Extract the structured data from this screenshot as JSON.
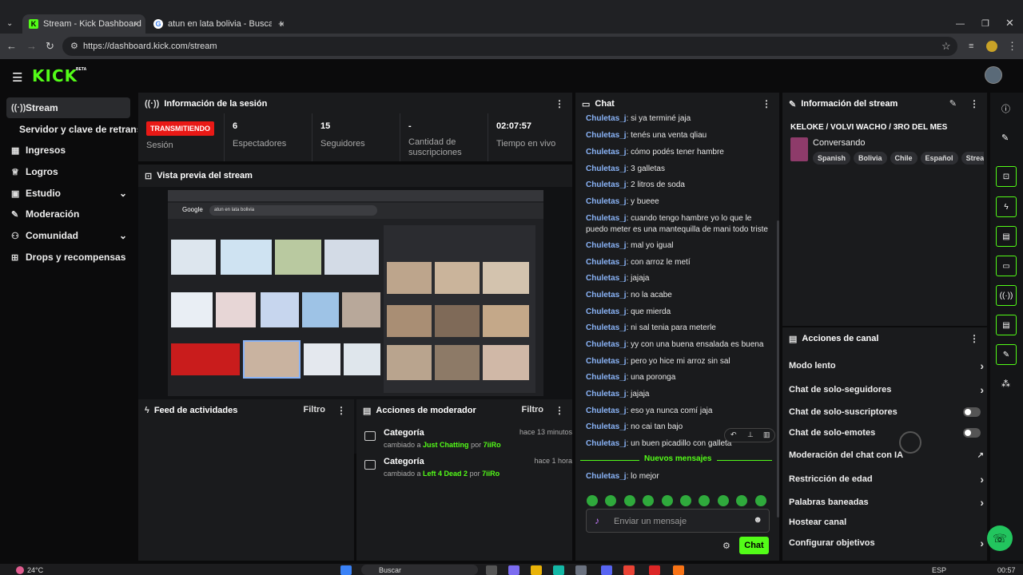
{
  "browser": {
    "tabs": [
      {
        "title": "Stream - Kick Dashboard",
        "active": true
      },
      {
        "title": "atun en lata bolivia - Buscar con",
        "active": false
      }
    ],
    "new_tab": "+",
    "url": "https://dashboard.kick.com/stream"
  },
  "header": {
    "logo": "KICK",
    "beta": "BETA"
  },
  "sidebar": {
    "items": [
      {
        "label": "Stream",
        "icon": "broadcast-icon"
      },
      {
        "label": "Servidor y clave de retransmisión",
        "icon": ""
      },
      {
        "label": "Ingresos",
        "icon": "chart-icon"
      },
      {
        "label": "Logros",
        "icon": "trophy-icon"
      },
      {
        "label": "Estudio",
        "icon": "studio-icon"
      },
      {
        "label": "Moderación",
        "icon": "wrench-icon"
      },
      {
        "label": "Comunidad",
        "icon": "community-icon"
      },
      {
        "label": "Drops y recompensas",
        "icon": "gift-icon"
      }
    ]
  },
  "session": {
    "title": "Información de la sesión",
    "badge": "TRANSMITIENDO",
    "badge_label": "Sesión",
    "stats": [
      {
        "value": "6",
        "label": "Espectadores"
      },
      {
        "value": "15",
        "label": "Seguidores"
      },
      {
        "value": "-",
        "label": "Cantidad de suscripciones"
      },
      {
        "value": "02:07:57",
        "label": "Tiempo en vivo"
      }
    ]
  },
  "preview": {
    "title": "Vista previa del stream",
    "embedded_search": "atun en lata bolivia",
    "embedded_logo": "Google"
  },
  "feed": {
    "title": "Feed de actividades",
    "filter": "Filtro"
  },
  "mod_actions": {
    "title": "Acciones de moderador",
    "filter": "Filtro",
    "items": [
      {
        "title": "Categoría",
        "prefix": "cambiado a",
        "value": "Just Chatting",
        "by": "por",
        "user": "7iiRo",
        "time": "hace 13 minutos"
      },
      {
        "title": "Categoría",
        "prefix": "cambiado a",
        "value": "Left 4 Dead 2",
        "by": "por",
        "user": "7iiRo",
        "time": "hace 1 hora"
      }
    ]
  },
  "chat": {
    "title": "Chat",
    "messages": [
      {
        "user": "Chuletas_j",
        "text": ": si ya terminé jaja"
      },
      {
        "user": "Chuletas_j",
        "text": ": tenés una venta qliau"
      },
      {
        "user": "Chuletas_j",
        "text": ": cómo podés tener hambre"
      },
      {
        "user": "Chuletas_j",
        "text": ": 3 galletas"
      },
      {
        "user": "Chuletas_j",
        "text": ": 2 litros de soda"
      },
      {
        "user": "Chuletas_j",
        "text": ": y bueee"
      },
      {
        "user": "Chuletas_j",
        "text": ": cuando tengo hambre yo lo que le puedo meter es una mantequilla de mani todo triste"
      },
      {
        "user": "Chuletas_j",
        "text": ": mal yo igual"
      },
      {
        "user": "Chuletas_j",
        "text": ": con arroz le metí"
      },
      {
        "user": "Chuletas_j",
        "text": ": jajaja"
      },
      {
        "user": "Chuletas_j",
        "text": ": no la acabe"
      },
      {
        "user": "Chuletas_j",
        "text": ": que mierda"
      },
      {
        "user": "Chuletas_j",
        "text": ": ni sal tenia para meterle"
      },
      {
        "user": "Chuletas_j",
        "text": ": yy con una buena ensalada es buena"
      },
      {
        "user": "Chuletas_j",
        "text": ": pero yo hice mi arroz sin sal"
      },
      {
        "user": "Chuletas_j",
        "text": ": una poronga"
      },
      {
        "user": "Chuletas_j",
        "text": ": jajaja"
      },
      {
        "user": "Chuletas_j",
        "text": ": eso ya nunca comí jaja"
      },
      {
        "user": "Chuletas_j",
        "text": ": no cai tan bajo"
      },
      {
        "user": "Chuletas_j",
        "text": ": un buen picadillo con galleta"
      }
    ],
    "new_messages": "Nuevos mensajes",
    "after": {
      "user": "Chuletas_j",
      "text": ": lo mejor"
    },
    "input_placeholder": "Enviar un mensaje",
    "send_label": "Chat"
  },
  "stream_info": {
    "title": "Información del stream",
    "stream_title": "KELOKE / VOLVI WACHO / 3RO DEL MES",
    "category": "Conversando",
    "tags": [
      "Spanish",
      "Bolivia",
      "Chile",
      "Español",
      "Streame"
    ]
  },
  "channel_actions": {
    "title": "Acciones de canal",
    "items": [
      {
        "label": "Modo lento",
        "control": "chevron"
      },
      {
        "label": "Chat de solo-seguidores",
        "control": "chevron"
      },
      {
        "label": "Chat de solo-suscriptores",
        "control": "toggle"
      },
      {
        "label": "Chat de solo-emotes",
        "control": "toggle"
      },
      {
        "label": "Moderación del chat con IA",
        "control": "external"
      },
      {
        "label": "Restricción de edad",
        "control": "chevron"
      },
      {
        "label": "Palabras baneadas",
        "control": "chevron"
      },
      {
        "label": "Hostear canal",
        "control": "none"
      },
      {
        "label": "Configurar objetivos",
        "control": "chevron"
      }
    ]
  },
  "taskbar": {
    "weather": "24°C",
    "search": "Buscar",
    "lang": "ESP",
    "time": "00:57"
  },
  "colors": {
    "accent": "#53fc18",
    "live": "#e91916",
    "username": "#8ab4f8"
  }
}
